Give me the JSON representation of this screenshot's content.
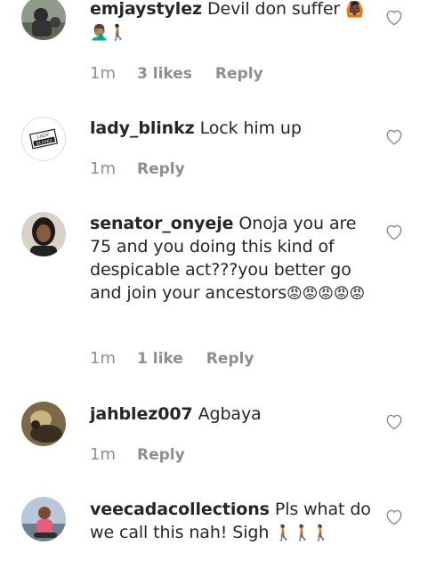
{
  "comments": [
    {
      "username": "emjaystylez",
      "text": "Devil don suffer",
      "emoji_inline": "🙆🏿",
      "emoji_line2": "🤦🏽‍♂️🚶🏿",
      "time": "1m",
      "likes": "3 likes",
      "reply": "Reply"
    },
    {
      "username": "lady_blinkz",
      "text": "Lock him up",
      "avatar_logo_text": "LADY BLINKZ",
      "time": "1m",
      "reply": "Reply"
    },
    {
      "username": "senator_onyeje",
      "text": "Onoja you are 75 and you doing this kind of despicable act???you better go and join your ancestors",
      "emoji_trail": "😡😡😡😡😡",
      "time": "1m",
      "likes": "1 like",
      "reply": "Reply"
    },
    {
      "username": "jahblez007",
      "text": "Agbaya",
      "time": "1m",
      "reply": "Reply"
    },
    {
      "username": "veecadacollections",
      "text": "Pls what do we call this nah! Sigh",
      "emoji_trail": "🚶🏾🚶🏾🚶🏾"
    }
  ],
  "colors": {
    "text": "#262626",
    "meta": "#8e8e8e",
    "heart_stroke": "#8e8e8e"
  },
  "icons": [
    "heart-outline-icon"
  ]
}
